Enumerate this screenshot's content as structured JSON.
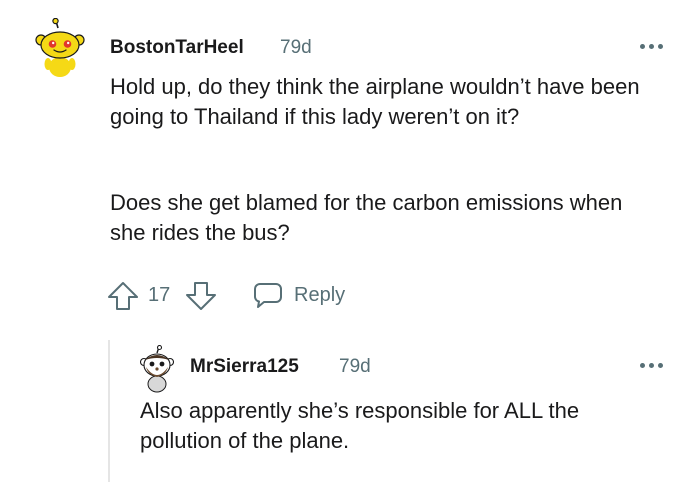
{
  "comment": {
    "avatar_icon": "snoo-avatar-icon",
    "username": "BostonTarHeel",
    "age": "79d",
    "more_icon": "more-options-icon",
    "paragraphs": [
      "Hold up, do they think the airplane wouldn’t have been going to Thailand if this lady weren’t on it?",
      "Does she get blamed for the carbon emissions when she rides the bus?"
    ],
    "votes": {
      "upvote_icon": "upvote-arrow-icon",
      "score": "17",
      "downvote_icon": "downvote-arrow-icon"
    },
    "reply_icon": "speech-bubble-icon",
    "reply_label": "Reply"
  },
  "reply": {
    "avatar_icon": "bearded-snoo-avatar-icon",
    "username": "MrSierra125",
    "age": "79d",
    "more_icon": "more-options-icon",
    "paragraphs": [
      "Also apparently she’s responsible for ALL the pollution of the plane."
    ]
  },
  "colors": {
    "text": "#1a1a1b",
    "meta": "#576f76",
    "snoo_yellow": "#f5d916",
    "thread_line": "#e5e5e5"
  }
}
